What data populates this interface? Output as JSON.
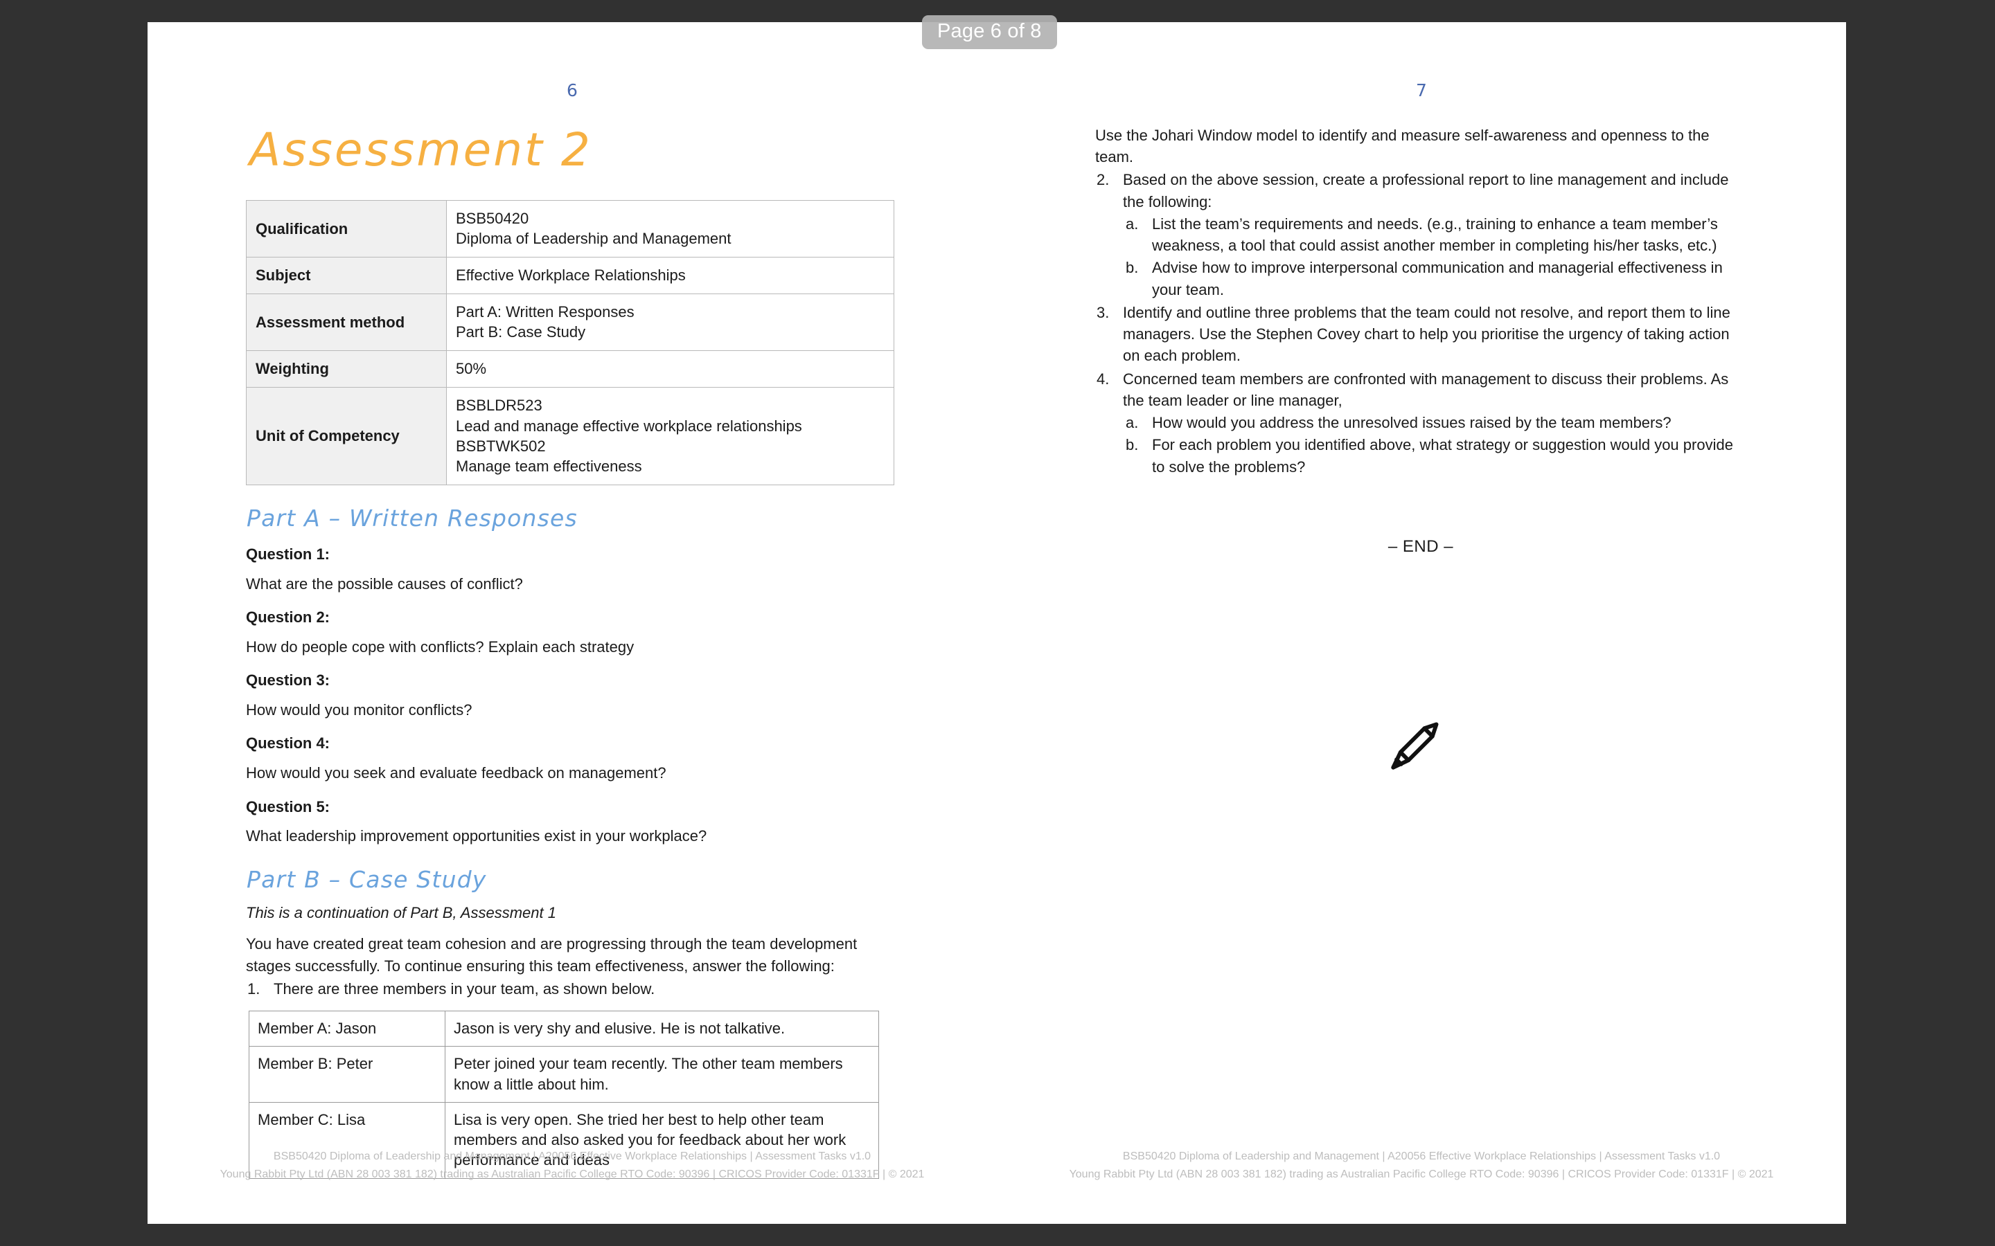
{
  "viewer": {
    "page_badge": "Page 6 of 8",
    "background_color": "#313131",
    "accent_orange": "#f6b042",
    "accent_blue": "#6aa3dd",
    "folio_color": "#4a6aaf",
    "cursor_icon": "pencil-icon"
  },
  "left_page": {
    "folio": "6",
    "title": "Assessment 2",
    "info_table": {
      "rows": [
        {
          "label": "Qualification",
          "lines": [
            "BSB50420",
            "Diploma of Leadership and Management"
          ]
        },
        {
          "label": "Subject",
          "lines": [
            "Effective Workplace Relationships"
          ]
        },
        {
          "label": "Assessment method",
          "lines": [
            "Part A: Written Responses",
            "Part B: Case Study"
          ]
        },
        {
          "label": "Weighting",
          "lines": [
            "50%"
          ]
        },
        {
          "label": "Unit of Competency",
          "lines": [
            "BSBLDR523",
            "Lead and manage effective workplace relationships",
            "BSBTWK502",
            "Manage team effectiveness"
          ]
        }
      ]
    },
    "part_a": {
      "heading": "Part A – Written Responses",
      "questions": [
        {
          "label": "Question 1:",
          "text": "What are the possible causes of conflict?"
        },
        {
          "label": "Question 2:",
          "text": "How do people cope with conflicts? Explain each strategy"
        },
        {
          "label": "Question 3:",
          "text": "How would you monitor conflicts?"
        },
        {
          "label": "Question 4:",
          "text": "How would you seek and evaluate feedback on management?"
        },
        {
          "label": "Question 5:",
          "text": "What leadership improvement opportunities exist in your workplace?"
        }
      ]
    },
    "part_b": {
      "heading": "Part B – Case Study",
      "continuation_note": "This is a continuation of Part B, Assessment 1",
      "intro": "You have created great team cohesion and are progressing through the team development stages successfully. To continue ensuring this team effectiveness, answer the following:",
      "item1_num": "1.",
      "item1_text": "There are three members in your team, as shown below.",
      "member_table": {
        "rows": [
          {
            "who": "Member A: Jason",
            "desc": "Jason is very shy and elusive. He is not talkative."
          },
          {
            "who": "Member B: Peter",
            "desc": "Peter joined your team recently. The other team members know a little about him."
          },
          {
            "who": "Member C: Lisa",
            "desc": "Lisa is very open. She tried her best to help other team members and also asked you for feedback about her work performance and ideas"
          }
        ]
      }
    },
    "footer": {
      "line1": "BSB50420 Diploma of Leadership and Management  |  A20056 Effective Workplace Relationships  |  Assessment Tasks v1.0",
      "line2": "Young Rabbit Pty Ltd (ABN 28 003 381 182) trading as Australian Pacific College RTO Code: 90396  |  CRICOS Provider Code: 01331F  |  © 2021"
    }
  },
  "right_page": {
    "folio": "7",
    "lead_text": "Use the Johari Window model to identify and measure self-awareness and openness to the team.",
    "items": [
      {
        "num": "2.",
        "text": "Based on the above session, create a professional report to line management and include the following:",
        "sub": [
          {
            "num": "a.",
            "text": "List the team’s requirements and needs. (e.g., training to enhance a team member’s weakness, a tool that could assist another member in completing his/her tasks, etc.)"
          },
          {
            "num": "b.",
            "text": "Advise how to improve interpersonal communication and managerial effectiveness in your team."
          }
        ]
      },
      {
        "num": "3.",
        "text": "Identify and outline three problems that the team could not resolve, and report them to line managers. Use the Stephen Covey chart to help you prioritise the urgency of taking action on each problem.",
        "sub": []
      },
      {
        "num": "4.",
        "text": "Concerned team members are confronted with management to discuss their problems. As the team leader or line manager,",
        "sub": [
          {
            "num": "a.",
            "text": "How would you address the unresolved issues raised by the team members?"
          },
          {
            "num": "b.",
            "text": "For each problem you identified above, what strategy or suggestion would you provide to solve the problems?"
          }
        ]
      }
    ],
    "end_marker": "– END –",
    "footer": {
      "line1": "BSB50420 Diploma of Leadership and Management  |  A20056 Effective Workplace Relationships  |  Assessment Tasks v1.0",
      "line2": "Young Rabbit Pty Ltd (ABN 28 003 381 182) trading as Australian Pacific College RTO Code: 90396  |  CRICOS Provider Code: 01331F  |  © 2021"
    }
  }
}
